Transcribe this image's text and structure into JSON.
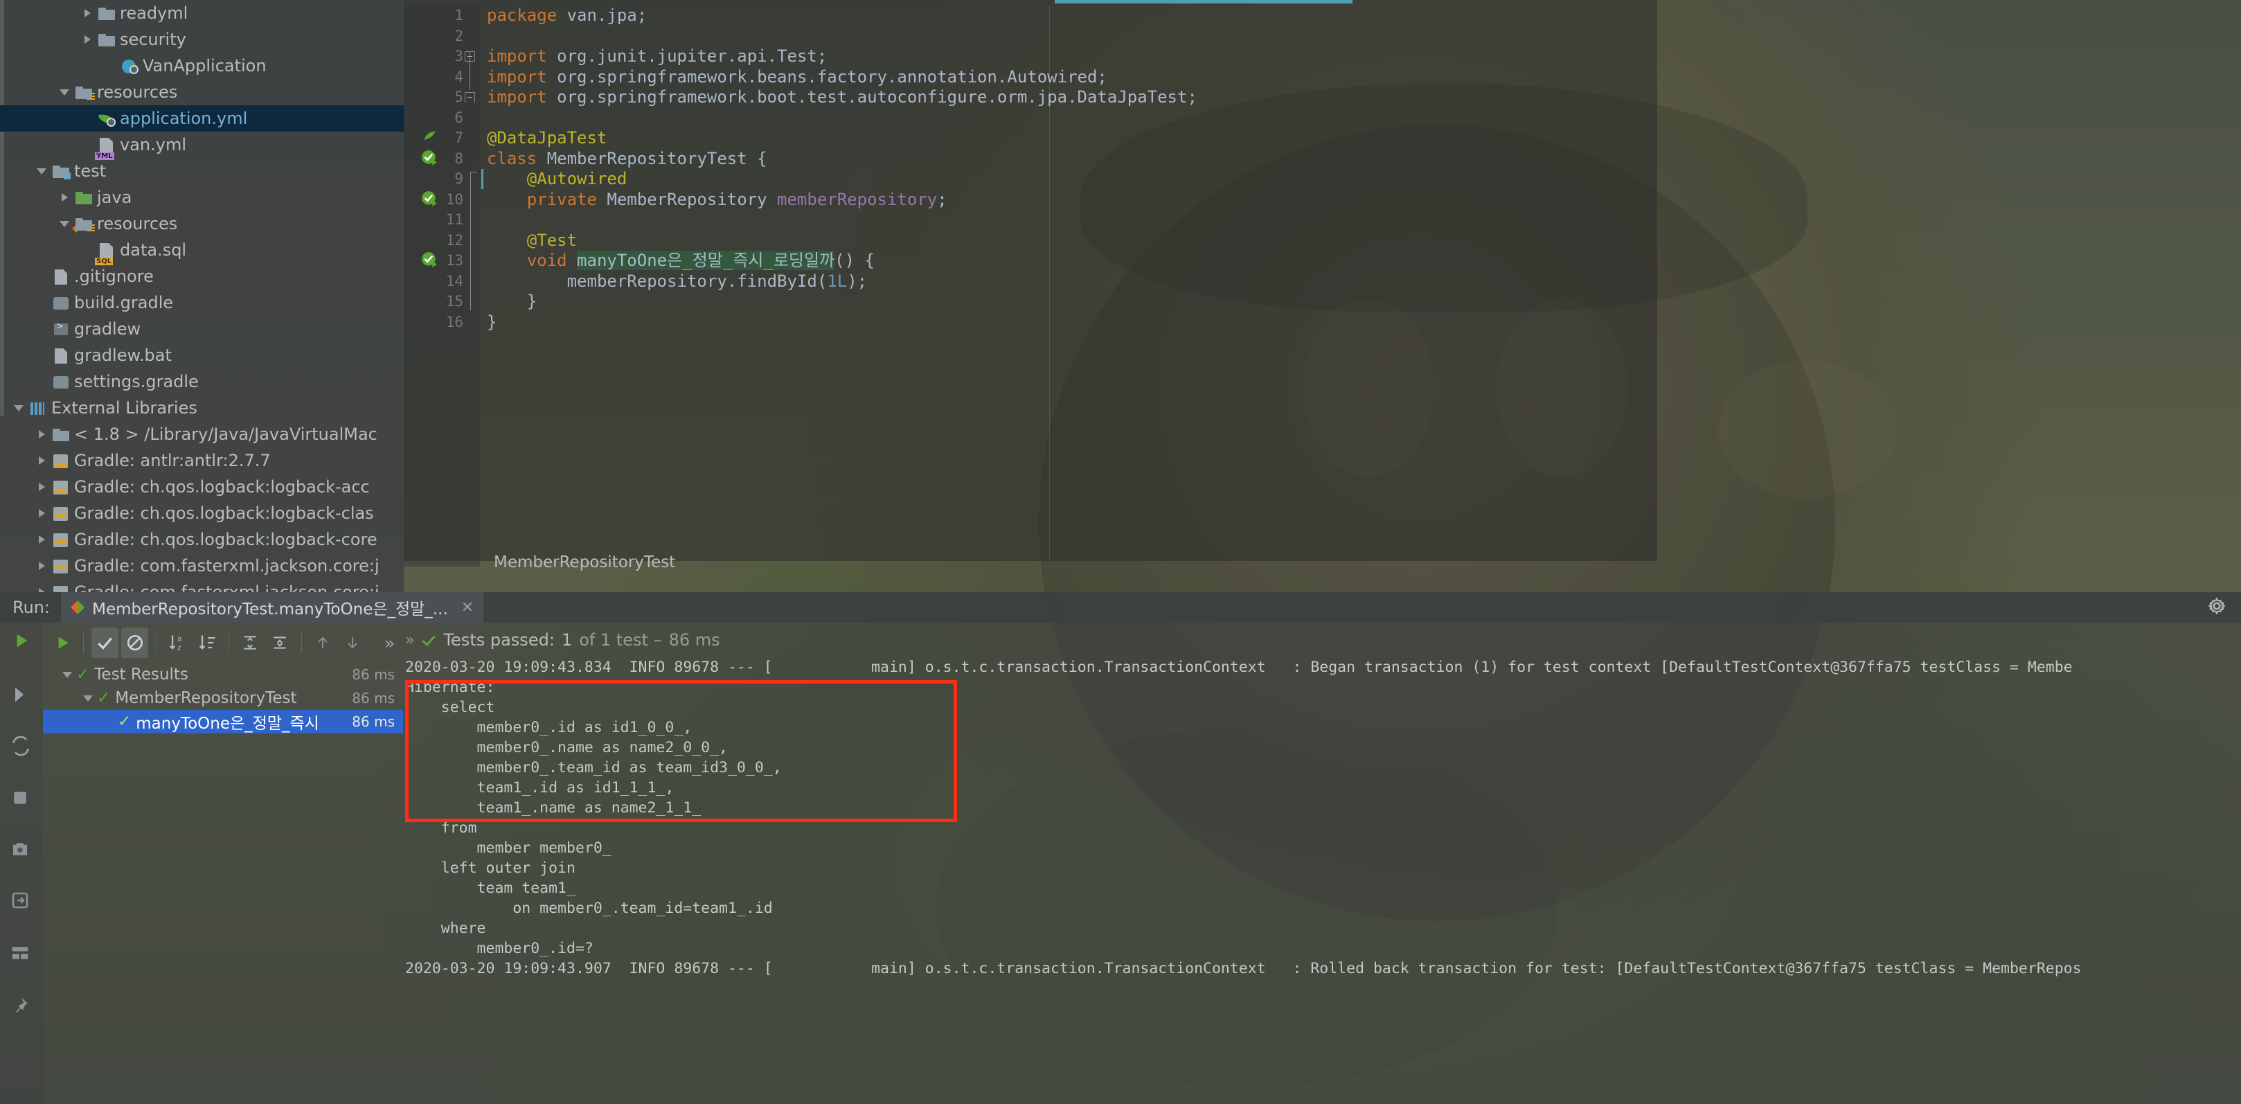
{
  "sidebar": {
    "tree": [
      {
        "indent": 3,
        "arrow": "closed",
        "icon": "folder",
        "label": "readyml"
      },
      {
        "indent": 3,
        "arrow": "closed",
        "icon": "folder",
        "label": "security"
      },
      {
        "indent": 4,
        "arrow": "none",
        "icon": "spring-app",
        "label": "VanApplication"
      },
      {
        "indent": 2,
        "arrow": "open",
        "icon": "folder-resources",
        "label": "resources"
      },
      {
        "indent": 3,
        "arrow": "none",
        "icon": "spring-yaml",
        "label": "application.yml",
        "selected": true
      },
      {
        "indent": 3,
        "arrow": "none",
        "icon": "file-yml",
        "label": "van.yml"
      },
      {
        "indent": 1,
        "arrow": "open",
        "icon": "folder-test",
        "label": "test"
      },
      {
        "indent": 2,
        "arrow": "closed",
        "icon": "folder-source",
        "label": "java"
      },
      {
        "indent": 2,
        "arrow": "open",
        "icon": "folder-test-resources",
        "label": "resources"
      },
      {
        "indent": 3,
        "arrow": "none",
        "icon": "file-sql",
        "label": "data.sql"
      },
      {
        "indent": 1,
        "arrow": "none",
        "icon": "file-text",
        "label": ".gitignore"
      },
      {
        "indent": 1,
        "arrow": "none",
        "icon": "file-gradle",
        "label": "build.gradle"
      },
      {
        "indent": 1,
        "arrow": "none",
        "icon": "file-script",
        "label": "gradlew"
      },
      {
        "indent": 1,
        "arrow": "none",
        "icon": "file-text",
        "label": "gradlew.bat"
      },
      {
        "indent": 1,
        "arrow": "none",
        "icon": "file-gradle",
        "label": "settings.gradle"
      },
      {
        "indent": 0,
        "arrow": "open",
        "icon": "libraries",
        "label": "External Libraries"
      },
      {
        "indent": 1,
        "arrow": "closed",
        "icon": "jdk",
        "label": "< 1.8 >  /Library/Java/JavaVirtualMac"
      },
      {
        "indent": 1,
        "arrow": "closed",
        "icon": "jar",
        "label": "Gradle: antlr:antlr:2.7.7"
      },
      {
        "indent": 1,
        "arrow": "closed",
        "icon": "jar",
        "label": "Gradle: ch.qos.logback:logback-acc"
      },
      {
        "indent": 1,
        "arrow": "closed",
        "icon": "jar",
        "label": "Gradle: ch.qos.logback:logback-clas"
      },
      {
        "indent": 1,
        "arrow": "closed",
        "icon": "jar",
        "label": "Gradle: ch.qos.logback:logback-core"
      },
      {
        "indent": 1,
        "arrow": "closed",
        "icon": "jar",
        "label": "Gradle: com.fasterxml.jackson.core:j"
      },
      {
        "indent": 1,
        "arrow": "closed",
        "icon": "jar",
        "label": "Gradle: com.fasterxml.jackson.core:j"
      }
    ]
  },
  "editor": {
    "breadcrumb": "MemberRepositoryTest",
    "lines": [
      {
        "n": "1",
        "tokens": [
          {
            "t": "package ",
            "c": "kw"
          },
          {
            "t": "van.jpa;",
            "c": "txt"
          }
        ]
      },
      {
        "n": "2",
        "tokens": []
      },
      {
        "n": "3",
        "fold": "start",
        "tokens": [
          {
            "t": "import ",
            "c": "kw"
          },
          {
            "t": "org.junit.jupiter.api.",
            "c": "txt"
          },
          {
            "t": "Test",
            "c": "cls"
          },
          {
            "t": ";",
            "c": "txt"
          }
        ]
      },
      {
        "n": "4",
        "tokens": [
          {
            "t": "import ",
            "c": "kw"
          },
          {
            "t": "org.springframework.beans.factory.annotation.",
            "c": "txt"
          },
          {
            "t": "Autowired",
            "c": "cls"
          },
          {
            "t": ";",
            "c": "txt"
          }
        ]
      },
      {
        "n": "5",
        "fold": "end",
        "tokens": [
          {
            "t": "import ",
            "c": "kw"
          },
          {
            "t": "org.springframework.boot.test.autoconfigure.orm.jpa.",
            "c": "txt"
          },
          {
            "t": "DataJpaTest",
            "c": "cls"
          },
          {
            "t": ";",
            "c": "txt"
          }
        ]
      },
      {
        "n": "6",
        "tokens": []
      },
      {
        "n": "7",
        "marker": "spring-leaf",
        "tokens": [
          {
            "t": "@DataJpaTest",
            "c": "ann"
          }
        ]
      },
      {
        "n": "8",
        "marker": "run-test",
        "tokens": [
          {
            "t": "class ",
            "c": "kw"
          },
          {
            "t": "MemberRepositoryTest ",
            "c": "txt"
          },
          {
            "t": "{",
            "c": "txt"
          }
        ]
      },
      {
        "n": "9",
        "tokens": [
          {
            "t": "    @Autowired",
            "c": "ann"
          }
        ]
      },
      {
        "n": "10",
        "marker": "run-method",
        "tokens": [
          {
            "t": "    private ",
            "c": "kw"
          },
          {
            "t": "MemberRepository ",
            "c": "txt"
          },
          {
            "t": "memberRepository",
            "c": "fld"
          },
          {
            "t": ";",
            "c": "txt"
          }
        ]
      },
      {
        "n": "11",
        "tokens": []
      },
      {
        "n": "12",
        "tokens": [
          {
            "t": "    @Test",
            "c": "ann"
          }
        ]
      },
      {
        "n": "13",
        "marker": "run-method",
        "tokens": [
          {
            "t": "    void ",
            "c": "kw"
          },
          {
            "t": "manyToOne은_정말_즉시_로딩일까",
            "c": "hl"
          },
          {
            "t": "() {",
            "c": "txt"
          }
        ]
      },
      {
        "n": "14",
        "tokens": [
          {
            "t": "        memberRepository.",
            "c": "txt"
          },
          {
            "t": "findById",
            "c": "txt"
          },
          {
            "t": "(",
            "c": "txt"
          },
          {
            "t": "1L",
            "c": "num"
          },
          {
            "t": ");",
            "c": "txt"
          }
        ]
      },
      {
        "n": "15",
        "tokens": [
          {
            "t": "    }",
            "c": "txt"
          }
        ]
      },
      {
        "n": "16",
        "tokens": [
          {
            "t": "}",
            "c": "txt"
          }
        ]
      }
    ]
  },
  "run_window": {
    "run_label": "Run:",
    "tab_title": "MemberRepositoryTest.manyToOne은_정말_...",
    "tab_close": "✕",
    "toolbar": [
      {
        "name": "rerun-button",
        "glyph": "▶"
      },
      {
        "name": "show-passed-toggle",
        "glyph": "✓",
        "active": true
      },
      {
        "name": "show-ignored-toggle",
        "glyph": "⊘",
        "active": true
      },
      {
        "name": "sort-alphabetically-button",
        "glyph": "↓ᵃᵤ"
      },
      {
        "name": "sort-by-duration-button",
        "glyph": "↓≡"
      },
      {
        "name": "expand-all-button",
        "glyph": "⇱"
      },
      {
        "name": "collapse-all-button",
        "glyph": "⇲"
      },
      {
        "name": "previous-failed-button",
        "glyph": "↑"
      },
      {
        "name": "next-failed-button",
        "glyph": "↓"
      }
    ],
    "tests": [
      {
        "indent": 0,
        "arrow": "open",
        "label": "Test Results",
        "time": "86 ms"
      },
      {
        "indent": 1,
        "arrow": "open",
        "label": "MemberRepositoryTest",
        "time": "86 ms"
      },
      {
        "indent": 2,
        "arrow": "none",
        "label": "manyToOne은_정말_즉시",
        "time": "86 ms",
        "selected": true
      }
    ],
    "status": {
      "chevrons": "»",
      "passed_label": "Tests passed:",
      "count": "1",
      "of_text": "of 1 test –",
      "duration": "86 ms"
    },
    "console": {
      "line_before": "2020-03-20 19:09:43.834  INFO 89678 --- [           main] o.s.t.c.transaction.TransactionContext   : Began transaction (1) for test context [DefaultTestContext@367ffa75 testClass = Membe",
      "highlighted_sql": [
        "Hibernate: ",
        "    select",
        "        member0_.id as id1_0_0_,",
        "        member0_.name as name2_0_0_,",
        "        member0_.team_id as team_id3_0_0_,",
        "        team1_.id as id1_1_1_,",
        "        team1_.name as name2_1_1_",
        "    from",
        "        member member0_",
        "    left outer join",
        "        team team1_",
        "            on member0_.team_id=team1_.id",
        "    where",
        "        member0_.id=?"
      ],
      "line_after": "2020-03-20 19:09:43.907  INFO 89678 --- [           main] o.s.t.c.transaction.TransactionContext   : Rolled back transaction for test: [DefaultTestContext@367ffa75 testClass = MemberRepos"
    }
  },
  "colors": {
    "accent_blue": "#2f65ca",
    "selection_navy": "#0d293e",
    "highlight_red": "#ff2d13",
    "keyword_orange": "#cc7832",
    "annotation_yellow": "#bbb529",
    "success_green": "#5aa832"
  }
}
